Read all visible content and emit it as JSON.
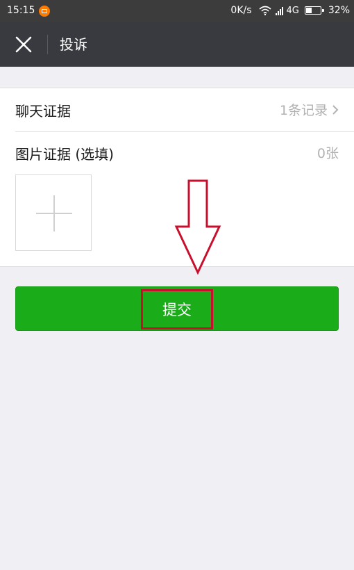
{
  "status_bar": {
    "time": "15:15",
    "speed": "0K/s",
    "network": "4G",
    "battery": "32%"
  },
  "header": {
    "title": "投诉",
    "close_icon": "close-icon"
  },
  "evidence": {
    "chat": {
      "label": "聊天证据",
      "value": "1条记录"
    },
    "image": {
      "label": "图片证据 (选填)",
      "value": "0张"
    },
    "add_icon": "plus-icon"
  },
  "submit": {
    "label": "提交"
  },
  "colors": {
    "header_bg": "#393a3f",
    "status_bg": "#3c3c3c",
    "page_bg": "#efeff4",
    "submit_green": "#1aad19",
    "annotation_red": "#c8102e"
  }
}
